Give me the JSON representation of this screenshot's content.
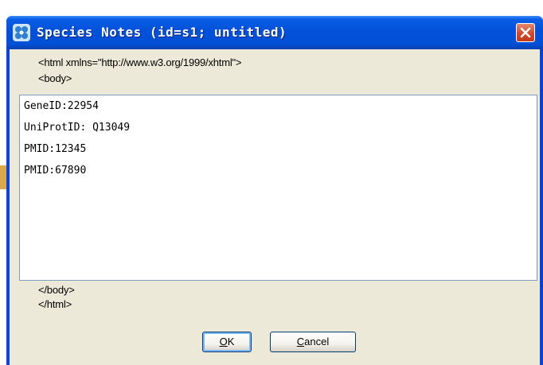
{
  "window": {
    "title": "Species Notes (id=s1; untitled)"
  },
  "markup": {
    "html_open": "<html xmlns=\"http://www.w3.org/1999/xhtml\">",
    "body_open": "<body>",
    "body_close": "</body>",
    "html_close": "</html>"
  },
  "notes": {
    "lines": [
      "GeneID:22954",
      "UniProtID: Q13049",
      "PMID:12345",
      "PMID:67890"
    ]
  },
  "buttons": {
    "ok_mnemonic": "O",
    "ok_rest": "K",
    "cancel_mnemonic": "C",
    "cancel_rest": "ancel"
  },
  "colors": {
    "titlebar": "#0250d5",
    "client_bg": "#ece9d8",
    "close": "#d04a28"
  }
}
